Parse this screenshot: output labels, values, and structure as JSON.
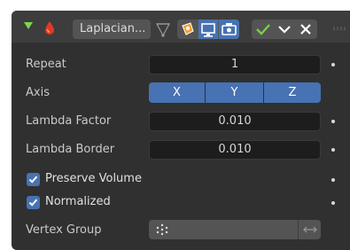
{
  "header": {
    "modifier_name": "Laplacian...",
    "icons": [
      "expand-chevron-icon",
      "smooth-modifier-icon",
      "edit-mode-icon",
      "on-cage-icon",
      "realtime-icon",
      "render-icon",
      "apply-check-icon",
      "dropdown-chevron-icon",
      "delete-x-icon",
      "drag-grip-icon"
    ]
  },
  "properties": {
    "repeat": {
      "label": "Repeat",
      "value": "1"
    },
    "axis": {
      "label": "Axis",
      "options": [
        "X",
        "Y",
        "Z"
      ],
      "selected": [
        "X",
        "Y",
        "Z"
      ]
    },
    "lambda_factor": {
      "label": "Lambda Factor",
      "value": "0.010"
    },
    "lambda_border": {
      "label": "Lambda Border",
      "value": "0.010"
    },
    "preserve_volume": {
      "label": "Preserve Volume",
      "checked": true
    },
    "normalized": {
      "label": "Normalized",
      "checked": true
    },
    "vertex_group": {
      "label": "Vertex Group",
      "value": ""
    }
  },
  "colors": {
    "panel_bg": "#303030",
    "header_bg": "#3d3d3d",
    "field_bg": "#1d1d1d",
    "accent_blue": "#4772b3",
    "check_green": "#76d13e",
    "drop_red": "#e23a22"
  }
}
